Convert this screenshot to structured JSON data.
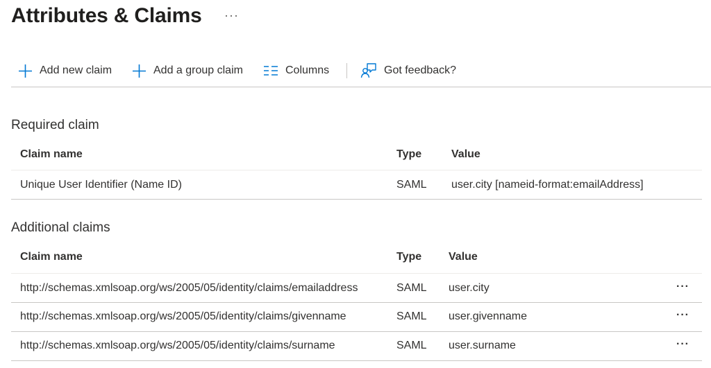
{
  "page": {
    "title": "Attributes & Claims",
    "more_label": "···"
  },
  "toolbar": {
    "add_claim": "Add new claim",
    "add_group_claim": "Add a group claim",
    "columns": "Columns",
    "feedback": "Got feedback?"
  },
  "required": {
    "section_title": "Required claim",
    "headers": {
      "name": "Claim name",
      "type": "Type",
      "value": "Value"
    },
    "rows": [
      {
        "name": "Unique User Identifier (Name ID)",
        "type": "SAML",
        "value": "user.city [nameid-format:emailAddress]"
      }
    ]
  },
  "additional": {
    "section_title": "Additional claims",
    "headers": {
      "name": "Claim name",
      "type": "Type",
      "value": "Value"
    },
    "more_label": "···",
    "rows": [
      {
        "name": "http://schemas.xmlsoap.org/ws/2005/05/identity/claims/emailaddress",
        "type": "SAML",
        "value": "user.city"
      },
      {
        "name": "http://schemas.xmlsoap.org/ws/2005/05/identity/claims/givenname",
        "type": "SAML",
        "value": "user.givenname"
      },
      {
        "name": "http://schemas.xmlsoap.org/ws/2005/05/identity/claims/surname",
        "type": "SAML",
        "value": "user.surname"
      }
    ]
  }
}
